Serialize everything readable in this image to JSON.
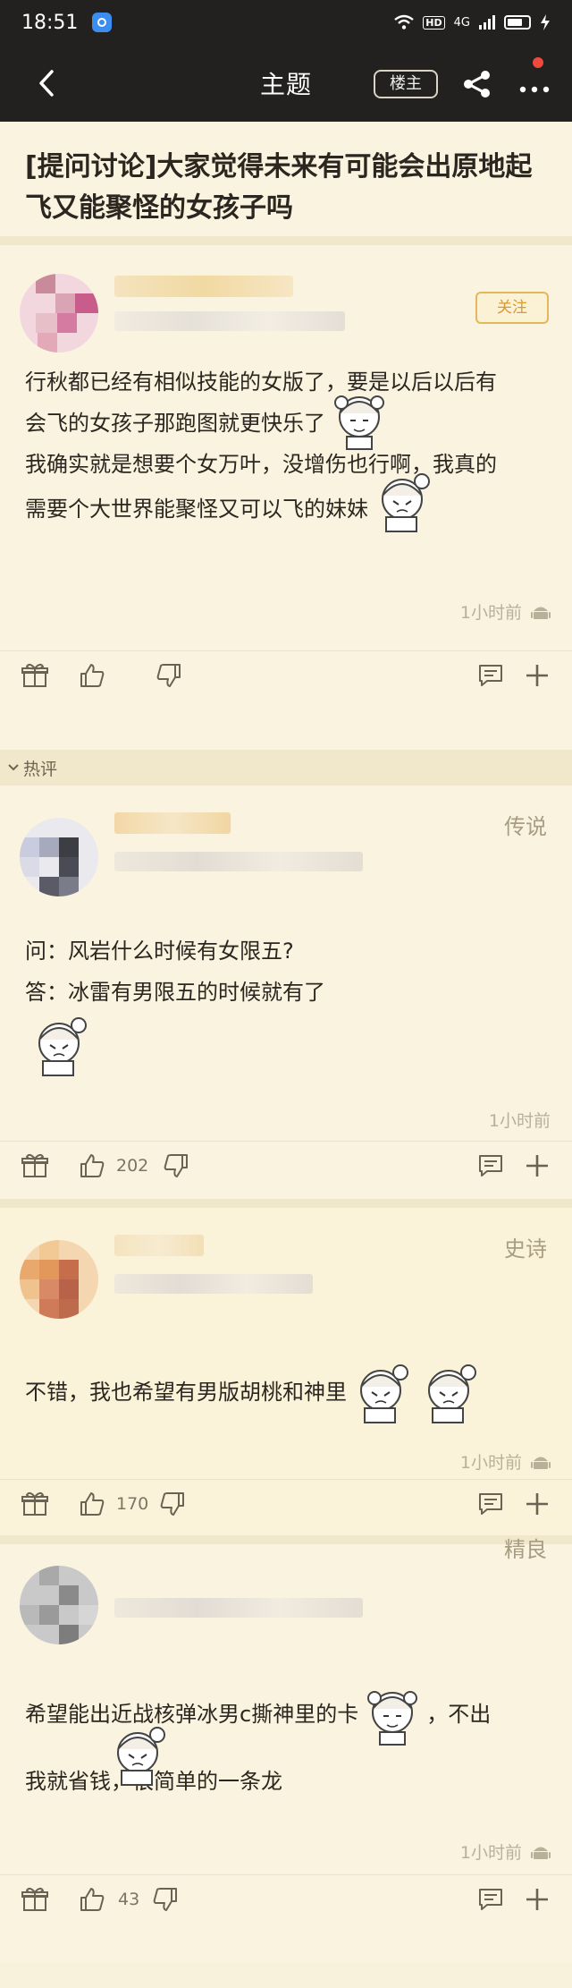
{
  "status_bar": {
    "time": "18:51",
    "hd": "HD",
    "signal": "4G"
  },
  "nav": {
    "title": "主题",
    "louzhu_label": "楼主"
  },
  "topic": {
    "title": "[提问讨论]大家觉得未来有可能会出原地起飞又能聚怪的女孩子吗"
  },
  "main_post": {
    "follow_label": "关注",
    "lines": [
      "行秋都已经有相似技能的女版了，要是以后以后有",
      "会飞的女孩子那跑图就更快乐了",
      "我确实就是想要个女万叶，没增伤也行啊，我真的",
      "需要个大世界能聚怪又可以飞的妹妹"
    ],
    "time": "1小时前"
  },
  "hot_label": "热评",
  "comments": [
    {
      "rank": "传说",
      "lines": [
        "问：风岩什么时候有女限五?",
        "答：冰雷有男限五的时候就有了"
      ],
      "time": "1小时前",
      "likes": "202"
    },
    {
      "rank": "史诗",
      "lines": [
        "不错，我也希望有男版胡桃和神里"
      ],
      "time": "1小时前",
      "likes": "170"
    },
    {
      "rank": "精良",
      "lines": [
        "希望能出近战核弹冰男c撕神里的卡",
        "，不出",
        "我就省钱，很简单的一条龙"
      ],
      "time": "1小时前",
      "likes": "43"
    }
  ],
  "colors": {
    "accent": "#e3b85b",
    "background": "#f8f1dc",
    "header": "#23211f"
  }
}
